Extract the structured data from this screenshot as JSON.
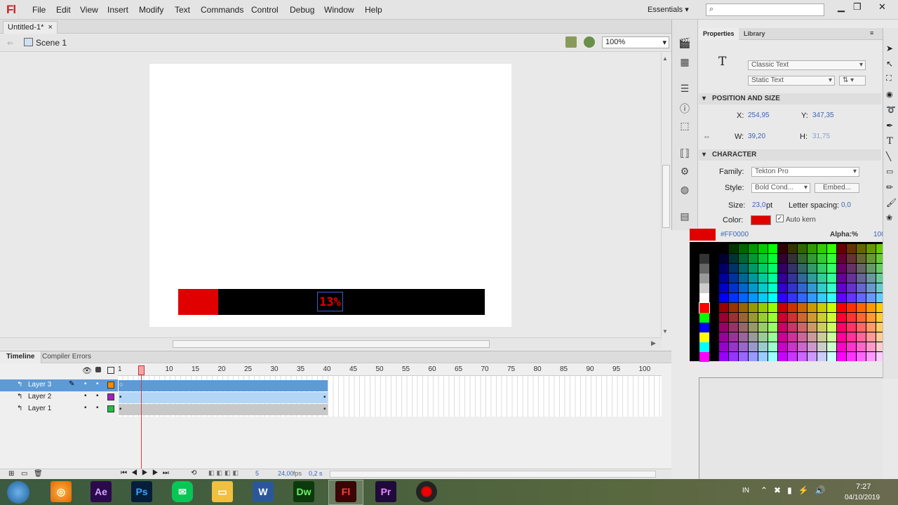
{
  "app": {
    "logo": "Fl",
    "workspace": "Essentials",
    "search_icon": "⌕"
  },
  "menu": [
    "File",
    "Edit",
    "View",
    "Insert",
    "Modify",
    "Text",
    "Commands",
    "Control",
    "Debug",
    "Window",
    "Help"
  ],
  "document": {
    "tab": "Untitled-1*",
    "close": "×",
    "scene": "Scene 1",
    "zoom": "100%"
  },
  "stage": {
    "progress_text": "13%",
    "progress_fraction": 0.13,
    "bar_color": "#000000",
    "fill_color": "#e00000"
  },
  "panels": {
    "properties_tab": "Properties",
    "library_tab": "Library"
  },
  "properties": {
    "text_engine": "Classic Text",
    "text_type": "Static Text",
    "position_section": "POSITION AND SIZE",
    "x_label": "X:",
    "x_value": "254,95",
    "y_label": "Y:",
    "y_value": "347,35",
    "w_label": "W:",
    "w_value": "39,20",
    "h_label": "H:",
    "h_value": "31,75",
    "character_section": "CHARACTER",
    "family_label": "Family:",
    "family_value": "Tekton Pro",
    "style_label": "Style:",
    "style_value": "Bold Cond...",
    "embed_button": "Embed...",
    "size_label": "Size:",
    "size_value": "23,0",
    "size_unit": "pt",
    "letter_spacing_label": "Letter spacing:",
    "letter_spacing_value": "0,0",
    "color_label": "Color:",
    "color_value": "#e00000",
    "auto_kern": "Auto kern"
  },
  "swatch": {
    "hex": "#FF0000",
    "alpha_label": "Alpha:%",
    "alpha_value": "100"
  },
  "timeline": {
    "tab": "Timeline",
    "compiler_tab": "Compiler Errors",
    "ruler": [
      "1",
      "5",
      "10",
      "15",
      "20",
      "25",
      "30",
      "35",
      "40",
      "45",
      "50",
      "55",
      "60",
      "65",
      "70",
      "75",
      "80",
      "85",
      "90",
      "95",
      "100"
    ],
    "layers": [
      {
        "name": "Layer 3",
        "color": "#ff8800",
        "selected": true
      },
      {
        "name": "Layer 2",
        "color": "#a020c0",
        "selected": false
      },
      {
        "name": "Layer 1",
        "color": "#20c040",
        "selected": false
      }
    ],
    "current_frame": "5",
    "fps": "24,00",
    "fps_unit": "fps",
    "time": "0,2 s"
  },
  "taskbar": {
    "apps": [
      "Ae",
      "Ps",
      "Dw",
      "Fl",
      "Pr"
    ],
    "lang": "IN",
    "time": "7:27",
    "date": "04/10/2019"
  }
}
